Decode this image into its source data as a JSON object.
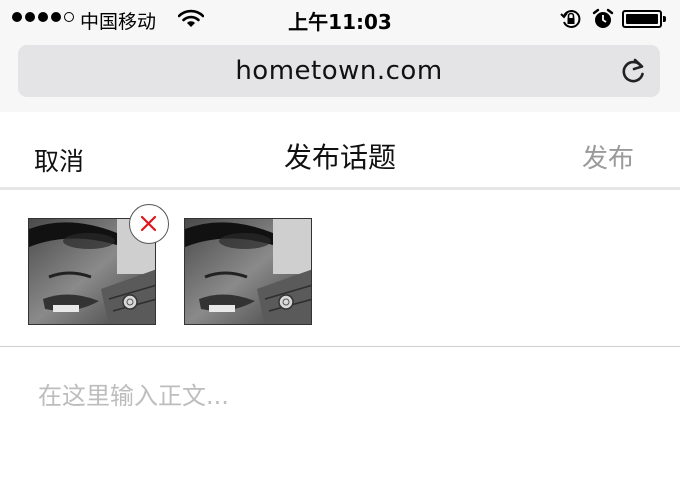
{
  "status_bar": {
    "carrier": "中国移动",
    "time": "上午11:03",
    "signal_filled": 4,
    "signal_total": 5,
    "icons": [
      "wifi-icon",
      "rotation-lock-icon",
      "alarm-icon",
      "battery-icon"
    ]
  },
  "browser": {
    "url": "hometown.com",
    "reload_icon": "reload-icon"
  },
  "header": {
    "cancel_label": "取消",
    "title": "发布话题",
    "publish_label": "发布"
  },
  "photos": {
    "count": 2,
    "remove_icon": "close-icon",
    "remove_color": "#e0161a"
  },
  "compose": {
    "placeholder": "在这里输入正文..."
  },
  "colors": {
    "bar_background": "#f7f7f7",
    "url_field": "#e4e4e6",
    "publish_disabled": "#9a9a9a",
    "placeholder": "#bdbdbd"
  }
}
